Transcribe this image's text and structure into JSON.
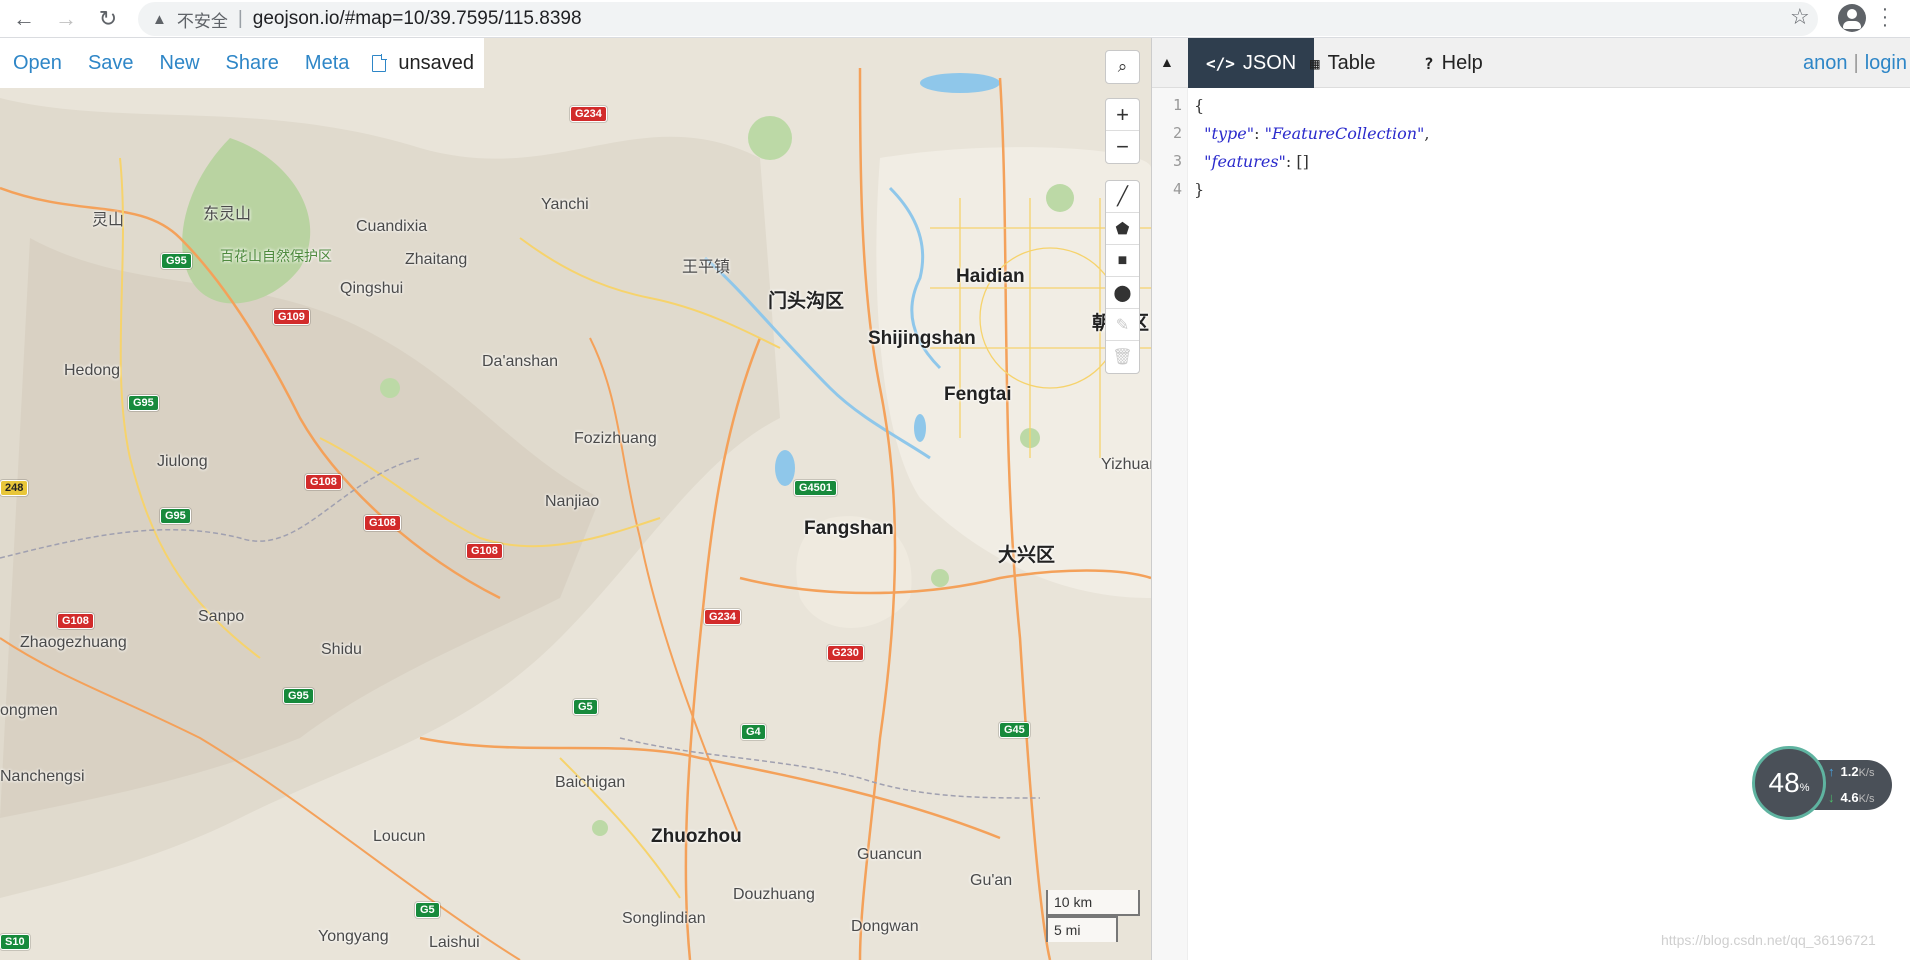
{
  "browser": {
    "security_label": "不安全",
    "url": "geojson.io/#map=10/39.7595/115.8398"
  },
  "map_toolbar": {
    "open": "Open",
    "save": "Save",
    "new": "New",
    "share": "Share",
    "meta": "Meta",
    "file_status": "unsaved"
  },
  "map_controls": {
    "search": "search-icon",
    "zoom_in": "+",
    "zoom_out": "−",
    "draw_tools": [
      "line-icon",
      "polygon-icon",
      "rectangle-icon",
      "marker-icon",
      "edit-icon",
      "trash-icon"
    ]
  },
  "scale": {
    "metric": "10 km",
    "imperial": "5 mi"
  },
  "map_labels": [
    {
      "name": "灵山"
    },
    {
      "name": "东灵山"
    },
    {
      "name": "百花山自然保护区"
    },
    {
      "name": "Cuandixia"
    },
    {
      "name": "Yanchi"
    },
    {
      "name": "Zhaitang"
    },
    {
      "name": "Qingshui"
    },
    {
      "name": "王平镇"
    },
    {
      "name": "门头沟区"
    },
    {
      "name": "Haidian"
    },
    {
      "name": "Shijingshan"
    },
    {
      "name": "朝阳区"
    },
    {
      "name": "Fengtai"
    },
    {
      "name": "Hedong"
    },
    {
      "name": "Da'anshan"
    },
    {
      "name": "Fozizhuang"
    },
    {
      "name": "Jiulong"
    },
    {
      "name": "Nanjiao"
    },
    {
      "name": "Fangshan"
    },
    {
      "name": "大兴区"
    },
    {
      "name": "Yizhuan"
    },
    {
      "name": "Sanpo"
    },
    {
      "name": "Zhaogezhuang"
    },
    {
      "name": "Shidu"
    },
    {
      "name": "ongmen"
    },
    {
      "name": "Nanchengsi"
    },
    {
      "name": "Baichigan"
    },
    {
      "name": "Loucun"
    },
    {
      "name": "Zhuozhou"
    },
    {
      "name": "Guancun"
    },
    {
      "name": "Gu'an"
    },
    {
      "name": "Douzhuang"
    },
    {
      "name": "Songlindian"
    },
    {
      "name": "Dongwan"
    },
    {
      "name": "Yongyang"
    },
    {
      "name": "Laishui"
    }
  ],
  "road_shields": [
    {
      "text": "G234"
    },
    {
      "text": "G95"
    },
    {
      "text": "G109"
    },
    {
      "text": "G95"
    },
    {
      "text": "248"
    },
    {
      "text": "G108"
    },
    {
      "text": "G95"
    },
    {
      "text": "G108"
    },
    {
      "text": "G108"
    },
    {
      "text": "G4501"
    },
    {
      "text": "G108"
    },
    {
      "text": "G234"
    },
    {
      "text": "G230"
    },
    {
      "text": "G95"
    },
    {
      "text": "G5"
    },
    {
      "text": "G4"
    },
    {
      "text": "G45"
    },
    {
      "text": "G5"
    },
    {
      "text": "S10"
    }
  ],
  "panel": {
    "tabs": {
      "json": "JSON",
      "table": "Table",
      "help": "Help"
    },
    "user": {
      "anon": "anon",
      "login": "login"
    },
    "editor_lines": [
      {
        "num": "1",
        "text": "{"
      },
      {
        "num": "2",
        "key": "\"type\"",
        "value": "\"FeatureCollection\""
      },
      {
        "num": "3",
        "key": "\"features\"",
        "value": "[]"
      },
      {
        "num": "4",
        "text": "}"
      }
    ]
  },
  "speed_widget": {
    "percent": "48",
    "unit": "%",
    "up": "1.2",
    "down": "4.6",
    "rate_unit": "K/s"
  },
  "watermark": "https://blog.csdn.net/qq_36196721",
  "colors": {
    "link": "#2e86c7",
    "active_tab": "#2f3e4e",
    "highway_red": "#d22b2b",
    "highway_green": "#178a3c"
  }
}
